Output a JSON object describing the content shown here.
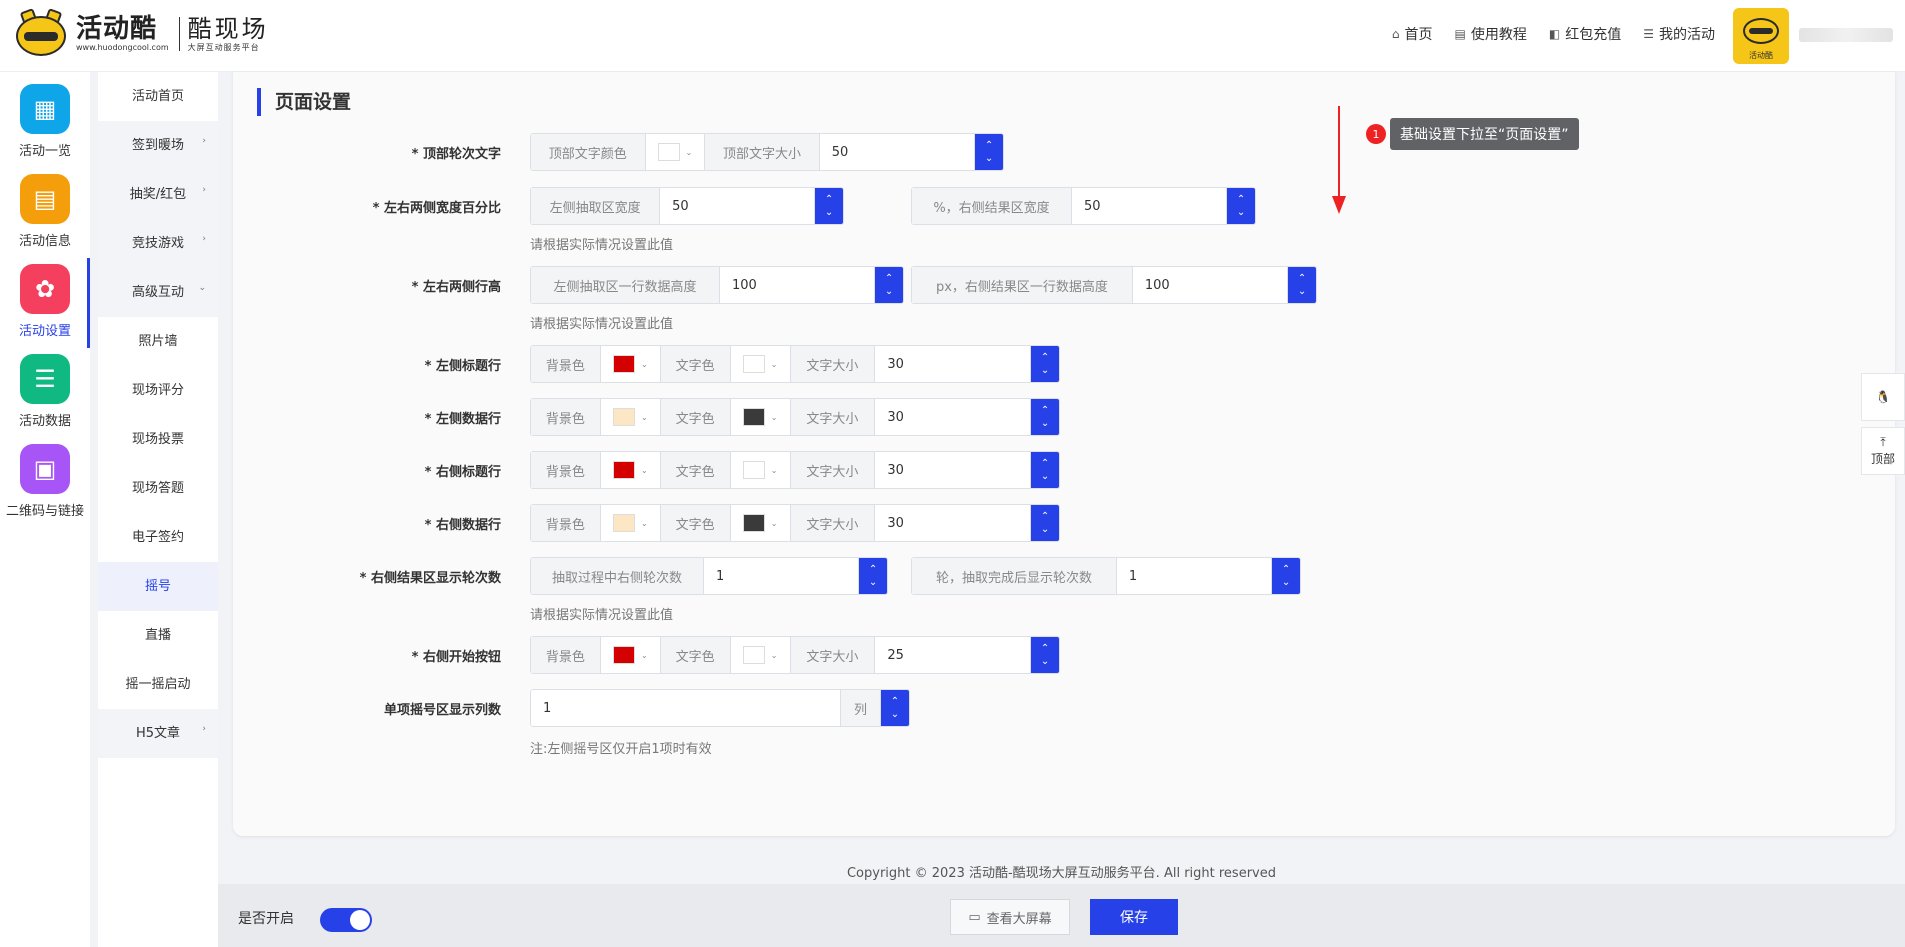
{
  "logo": {
    "brand": "活动酷",
    "brand_url": "www.huodongcool.com",
    "product": "酷现场",
    "product_sub": "大屏互动服务平台"
  },
  "topnav": [
    {
      "icon": "home-icon",
      "glyph": "⌂",
      "label": "首页"
    },
    {
      "icon": "document-icon",
      "glyph": "▤",
      "label": "使用教程"
    },
    {
      "icon": "wallet-icon",
      "glyph": "◧",
      "label": "红包充值"
    },
    {
      "icon": "list-icon",
      "glyph": "☰",
      "label": "我的活动"
    }
  ],
  "avatar_caption": "活动酷",
  "iconbar": [
    {
      "label": "活动一览",
      "color": "#0ea5e9",
      "glyph": "▦",
      "icon": "grid-icon"
    },
    {
      "label": "活动信息",
      "color": "#f59e0b",
      "glyph": "▤",
      "icon": "file-icon"
    },
    {
      "label": "活动设置",
      "color": "#f43f5e",
      "glyph": "✿",
      "icon": "gear-icon"
    },
    {
      "label": "活动数据",
      "color": "#10b981",
      "glyph": "☰",
      "icon": "database-icon"
    },
    {
      "label": "二维码与链接",
      "color": "#a855f7",
      "glyph": "▣",
      "icon": "qrcode-icon"
    }
  ],
  "subnav": [
    {
      "label": "活动首页",
      "caret": ""
    },
    {
      "label": "签到暖场",
      "caret": "›"
    },
    {
      "label": "抽奖/红包",
      "caret": "›"
    },
    {
      "label": "竞技游戏",
      "caret": "›"
    },
    {
      "label": "高级互动",
      "caret": "⌄"
    },
    {
      "label": "照片墙",
      "caret": ""
    },
    {
      "label": "现场评分",
      "caret": ""
    },
    {
      "label": "现场投票",
      "caret": ""
    },
    {
      "label": "现场答题",
      "caret": ""
    },
    {
      "label": "电子签约",
      "caret": ""
    },
    {
      "label": "摇号",
      "caret": ""
    },
    {
      "label": "直播",
      "caret": ""
    },
    {
      "label": "摇一摇启动",
      "caret": ""
    },
    {
      "label": "H5文章",
      "caret": "›"
    }
  ],
  "section_title": "页面设置",
  "tip": {
    "number": "1",
    "text": "基础设置下拉至“页面设置”"
  },
  "form": {
    "r1": {
      "label": "* 顶部轮次文字",
      "a1": "顶部文字颜色",
      "c1": "#ffffff",
      "a2": "顶部文字大小",
      "v": "50"
    },
    "r2": {
      "label": "* 左右两侧宽度百分比",
      "a1": "左侧抽取区宽度",
      "v1": "50",
      "a2": "%，右侧结果区宽度",
      "v2": "50",
      "hint": "请根据实际情况设置此值"
    },
    "r3": {
      "label": "* 左右两侧行高",
      "a1": "左侧抽取区一行数据高度",
      "v1": "100",
      "a2": "px，右侧结果区一行数据高度",
      "v2": "100",
      "hint": "请根据实际情况设置此值"
    },
    "r4": {
      "label": "* 左侧标题行",
      "bg": "背景色",
      "bgc": "#d40000",
      "fg": "文字色",
      "fgc": "#ffffff",
      "sz": "文字大小",
      "v": "30"
    },
    "r5": {
      "label": "* 左侧数据行",
      "bg": "背景色",
      "bgc": "#fde6c4",
      "fg": "文字色",
      "fgc": "#3a3a3a",
      "sz": "文字大小",
      "v": "30"
    },
    "r6": {
      "label": "* 右侧标题行",
      "bg": "背景色",
      "bgc": "#d40000",
      "fg": "文字色",
      "fgc": "#ffffff",
      "sz": "文字大小",
      "v": "30"
    },
    "r7": {
      "label": "* 右侧数据行",
      "bg": "背景色",
      "bgc": "#fde6c4",
      "fg": "文字色",
      "fgc": "#3a3a3a",
      "sz": "文字大小",
      "v": "30"
    },
    "r8": {
      "label": "* 右侧结果区显示轮次数",
      "a1": "抽取过程中右侧轮次数",
      "v1": "1",
      "a2": "轮，抽取完成后显示轮次数",
      "v2": "1",
      "hint": "请根据实际情况设置此值"
    },
    "r9": {
      "label": "* 右侧开始按钮",
      "bg": "背景色",
      "bgc": "#d40000",
      "fg": "文字色",
      "fgc": "#ffffff",
      "sz": "文字大小",
      "v": "25"
    },
    "r10": {
      "label": "单项摇号区显示列数",
      "v": "1",
      "unit": "列",
      "hint": "注:左侧摇号区仅开启1项时有效"
    }
  },
  "float": {
    "top_label": "顶部",
    "top_glyph": "⤒",
    "qq_glyph": "🐧"
  },
  "footer": {
    "copyright": "Copyright © 2023 活动酷-酷现场大屏互动服务平台. All right reserved"
  },
  "bottombar": {
    "enable_label": "是否开启",
    "view_label": "查看大屏幕",
    "save_label": "保存"
  }
}
